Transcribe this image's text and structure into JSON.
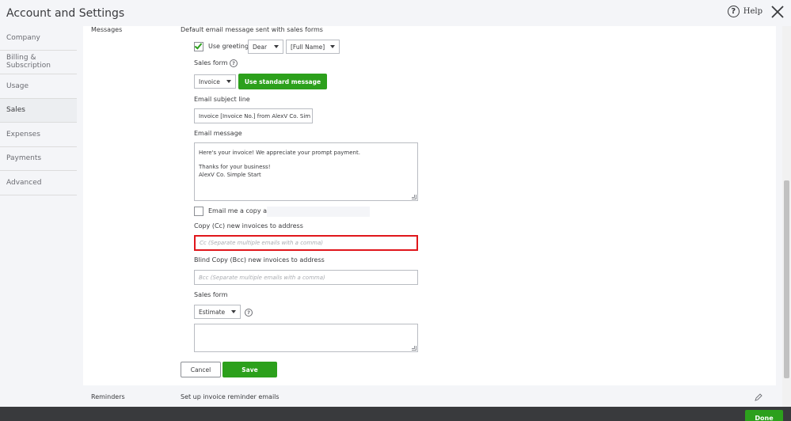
{
  "header": {
    "title": "Account and Settings",
    "help_label": "Help"
  },
  "sidebar": {
    "items": [
      {
        "label": "Company"
      },
      {
        "label": "Billing & Subscription"
      },
      {
        "label": "Usage"
      },
      {
        "label": "Sales"
      },
      {
        "label": "Expenses"
      },
      {
        "label": "Payments"
      },
      {
        "label": "Advanced"
      }
    ]
  },
  "messages": {
    "section_label": "Messages",
    "description": "Default email message sent with sales forms",
    "use_greeting_label": "Use greeting",
    "use_greeting_checked": true,
    "greeting_select": "Dear",
    "name_select": "[Full Name]",
    "sales_form_label": "Sales form",
    "sales_form_select": "Invoice",
    "use_standard_button": "Use standard message",
    "subject_label": "Email subject line",
    "subject_value": "Invoice [Invoice No.] from AlexV Co. Sim",
    "message_label": "Email message",
    "message_line1": "Here's your invoice! We appreciate your prompt payment.",
    "message_line2": "Thanks for your business!",
    "message_line3": "AlexV Co. Simple Start",
    "email_copy_label": "Email me a copy at",
    "email_copy_checked": false,
    "cc_label": "Copy (Cc) new invoices to address",
    "cc_placeholder": "Cc (Separate multiple emails with a comma)",
    "bcc_label": "Blind Copy (Bcc) new invoices to address",
    "bcc_placeholder": "Bcc (Separate multiple emails with a comma)",
    "sales_form2_label": "Sales form",
    "sales_form2_select": "Estimate",
    "cancel_button": "Cancel",
    "save_button": "Save"
  },
  "reminders": {
    "section_label": "Reminders",
    "description": "Set up invoice reminder emails"
  },
  "footer": {
    "done_button": "Done"
  },
  "colors": {
    "accent": "#2ca01c",
    "highlight": "#e0161b",
    "footer": "#393a3d"
  }
}
